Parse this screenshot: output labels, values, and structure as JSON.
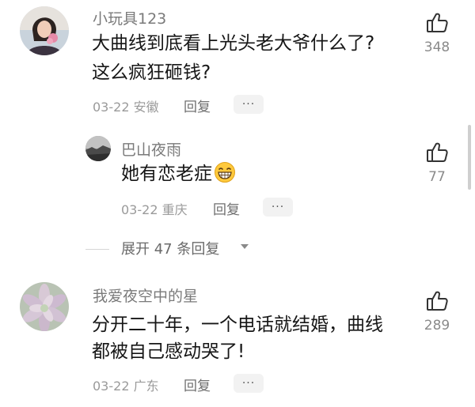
{
  "comments": [
    {
      "username": "小玩具123",
      "content_lines": [
        "大曲线到底看上光头老大爷什么了?",
        "这么疯狂砸钱?"
      ],
      "date": "03-22",
      "location": "安徽",
      "reply_label": "回复",
      "more_label": "···",
      "likes": "348"
    },
    {
      "username": "巴山夜雨",
      "content_lines": [
        "她有恋老症"
      ],
      "emoji": "grin-emoji",
      "date": "03-22",
      "location": "重庆",
      "reply_label": "回复",
      "more_label": "···",
      "likes": "77"
    },
    {
      "username": "我爱夜空中的星",
      "content_lines": [
        "分开二十年，一个电话就结婚，曲线",
        "都被自己感动哭了!"
      ],
      "date": "03-22",
      "location": "广东",
      "reply_label": "回复",
      "more_label": "···",
      "likes": "289"
    }
  ],
  "expand_replies": {
    "label": "展开 47 条回复"
  },
  "icons": {
    "like": "thumbs-up-icon",
    "expand": "chevron-down-icon"
  },
  "colors": {
    "text": "#161616",
    "meta": "#9a9a9a",
    "username": "#7a7a7a",
    "chip": "#f2f2f2"
  }
}
